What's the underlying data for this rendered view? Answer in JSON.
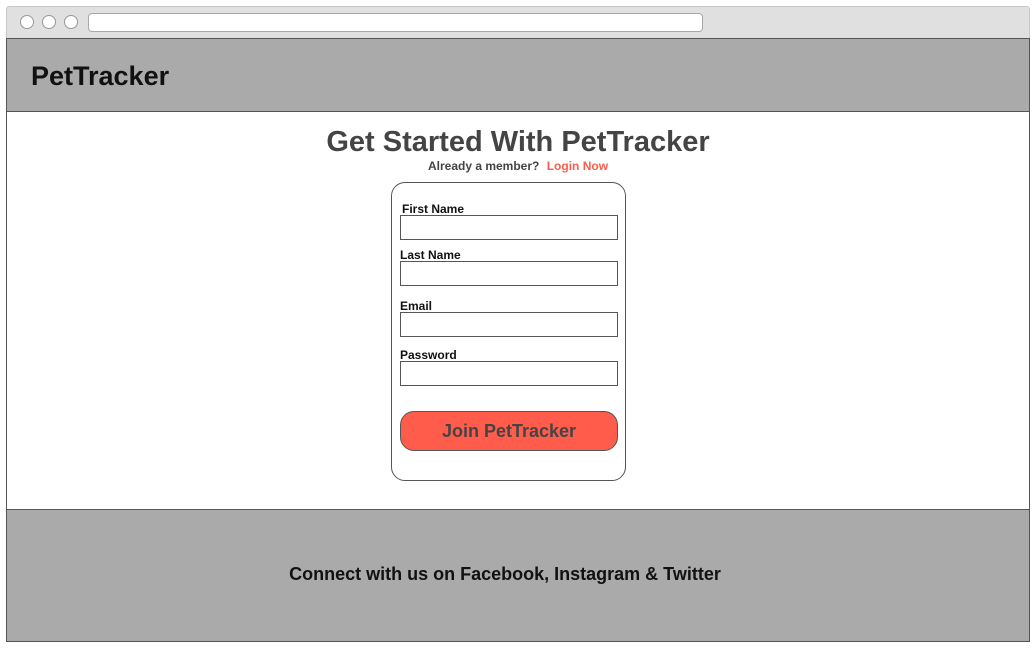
{
  "browser": {
    "address_value": "",
    "window_controls": [
      "close-dot",
      "minimize-dot",
      "maximize-dot"
    ]
  },
  "header": {
    "brand": "PetTracker",
    "background_color": "#aaaaaa"
  },
  "signup": {
    "title": "Get Started With PetTracker",
    "member_prompt": "Already a member?",
    "login_link": "Login Now",
    "fields": [
      {
        "label": "First Name",
        "value": ""
      },
      {
        "label": "Last Name",
        "value": ""
      },
      {
        "label": "Email",
        "value": ""
      },
      {
        "label": "Password",
        "value": ""
      }
    ],
    "submit_label": "Join PetTracker",
    "accent_color": "#ff5c4c"
  },
  "footer": {
    "text": "Connect with us on Facebook, Instagram & Twitter"
  }
}
